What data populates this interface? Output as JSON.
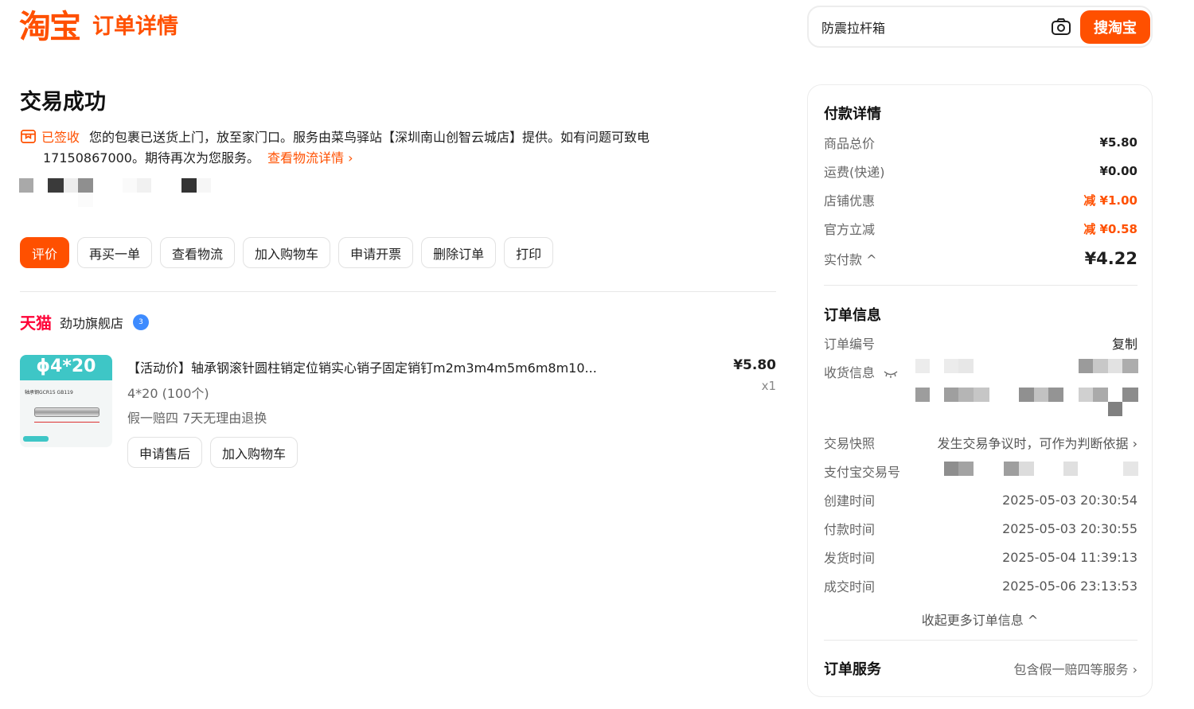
{
  "header": {
    "logo": "淘宝",
    "page_title": "订单详情"
  },
  "search": {
    "value": "防震拉杆箱",
    "button_label": "搜淘宝",
    "camera_icon": "camera-icon"
  },
  "order_status": {
    "title": "交易成功",
    "signed_label": "已签收",
    "signed_text_line1": "您的包裹已送货上门，放至家门口。服务由菜鸟驿站【深圳南山创智云城店】提供。如有问题可致电",
    "signed_text_line2": "17150867000。期待再次为您服务。",
    "logistics_link": "查看物流详情 ›"
  },
  "actions": [
    {
      "label": "评价",
      "primary": true
    },
    {
      "label": "再买一单"
    },
    {
      "label": "查看物流"
    },
    {
      "label": "加入购物车"
    },
    {
      "label": "申请开票"
    },
    {
      "label": "删除订单"
    },
    {
      "label": "打印"
    }
  ],
  "shop": {
    "platform": "天猫",
    "name": "劲功旗舰店",
    "badge": "3"
  },
  "product": {
    "image_spec": "ϕ4*20",
    "image_text": "轴承钢GCR15 GB119",
    "title": "【活动价】轴承钢滚针圆柱销定位销实心销子固定销钉m2m3m4m5m6m8m10...",
    "sku": "4*20 (100个)",
    "service": "假一赔四 7天无理由退换",
    "price": "¥5.80",
    "quantity": "x1",
    "actions": [
      "申请售后",
      "加入购物车"
    ]
  },
  "payment": {
    "title": "付款详情",
    "rows": [
      {
        "label": "商品总价",
        "value": "¥5.80"
      },
      {
        "label": "运费(快递)",
        "value": "¥0.00"
      },
      {
        "label": "店铺优惠",
        "value": "减 ¥1.00"
      },
      {
        "label": "官方立减",
        "value": "减 ¥0.58"
      },
      {
        "label": "实付款 ^",
        "value": "¥4.22"
      }
    ]
  },
  "order_info": {
    "title": "订单信息",
    "order_no_label": "订单编号",
    "copy_label": "复制",
    "receiver_label": "收货信息",
    "snapshot_label": "交易快照",
    "snapshot_value": "发生交易争议时，可作为判断依据 ›",
    "alipay_label": "支付宝交易号",
    "times": [
      {
        "label": "创建时间",
        "value": "2025-05-03 20:30:54"
      },
      {
        "label": "付款时间",
        "value": "2025-05-03 20:30:55"
      },
      {
        "label": "发货时间",
        "value": "2025-05-04 11:39:13"
      },
      {
        "label": "成交时间",
        "value": "2025-05-06 23:13:53"
      }
    ],
    "collapse_label": "收起更多订单信息 ^"
  },
  "order_service": {
    "title": "订单服务",
    "value": "包含假一赔四等服务 ›"
  },
  "colors": {
    "accent": "#ff5000",
    "tmall": "#ff0036"
  }
}
